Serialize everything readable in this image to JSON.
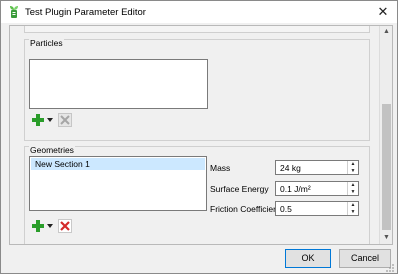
{
  "window": {
    "title": "Test Plugin Parameter Editor",
    "close_glyph": "✕"
  },
  "particles": {
    "title": "Particles",
    "add_icon": "add-icon",
    "remove_icon": "remove-icon"
  },
  "geometries": {
    "title": "Geometries",
    "items": [
      "New Section 1"
    ],
    "fields": [
      {
        "label": "Mass",
        "value": "24 kg"
      },
      {
        "label": "Surface Energy",
        "value": "0.1 J/m²"
      },
      {
        "label": "Friction Coefficient",
        "value": "0.5"
      }
    ]
  },
  "buttons": {
    "ok": "OK",
    "cancel": "Cancel"
  },
  "colors": {
    "accent": "#0078d7",
    "selection": "#cce8ff",
    "add_green": "#2a9d2a",
    "remove_red": "#d42a2a"
  }
}
